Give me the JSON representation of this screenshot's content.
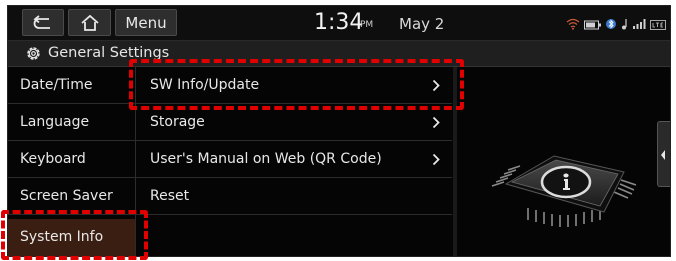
{
  "topbar": {
    "menu_label": "Menu",
    "time": "1:34",
    "ampm": "PM",
    "date": "May 2"
  },
  "title_bar": {
    "title": "General Settings"
  },
  "left_menu": [
    {
      "label": "Date/Time"
    },
    {
      "label": "Language"
    },
    {
      "label": "Keyboard"
    },
    {
      "label": "Screen Saver"
    },
    {
      "label": "System Info",
      "selected": true
    }
  ],
  "right_menu": [
    {
      "label": "SW Info/Update",
      "chevron": true
    },
    {
      "label": "Storage",
      "chevron": true
    },
    {
      "label": "User's Manual on Web (QR Code)",
      "chevron": true
    },
    {
      "label": "Reset",
      "chevron": false
    }
  ],
  "colors": {
    "highlight": "#e00000",
    "selected_bg": "#3a1e12",
    "background": "#050505"
  },
  "icons": [
    "back-icon",
    "home-icon",
    "gear-icon",
    "chevron-right-icon",
    "info-chip-icon",
    "chevron-left-icon",
    "wifi-icon",
    "battery-icon",
    "bluetooth-icon",
    "signal-icon",
    "lte-icon"
  ]
}
